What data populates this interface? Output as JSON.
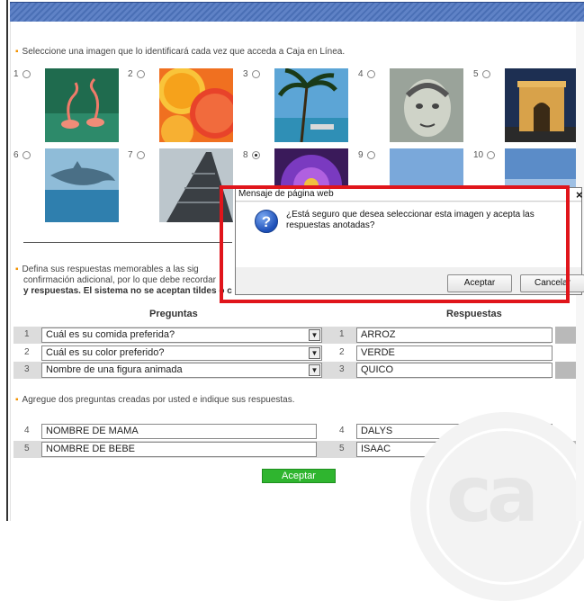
{
  "section1": {
    "instruction": "Seleccione una imagen que lo identificará cada vez que acceda a Caja en Línea."
  },
  "images": [
    {
      "num": "1",
      "subject": "flamingos",
      "selected": false
    },
    {
      "num": "2",
      "subject": "citrus slices",
      "selected": false
    },
    {
      "num": "3",
      "subject": "palm trees beach",
      "selected": false
    },
    {
      "num": "4",
      "subject": "dollar bill portrait",
      "selected": false
    },
    {
      "num": "5",
      "subject": "triumphal arch",
      "selected": false
    },
    {
      "num": "6",
      "subject": "dolphin",
      "selected": false
    },
    {
      "num": "7",
      "subject": "eiffel tower",
      "selected": false
    },
    {
      "num": "8",
      "subject": "purple flower",
      "selected": true
    },
    {
      "num": "9",
      "subject": "sky",
      "selected": false
    },
    {
      "num": "10",
      "subject": "sky horizon",
      "selected": false
    }
  ],
  "section2": {
    "line1": "Defina sus respuestas memorables a las sig",
    "line2": "confirmación adicional, por lo que debe recordar",
    "line3": "y respuestas. El sistema no se aceptan tildes o c"
  },
  "headers": {
    "questions": "Preguntas",
    "answers": "Respuestas"
  },
  "questions": [
    {
      "num": "1",
      "text": "Cuál es su comida preferida?",
      "answer_num": "1",
      "answer": "ARROZ"
    },
    {
      "num": "2",
      "text": "Cuál es su color preferido?",
      "answer_num": "2",
      "answer": "VERDE"
    },
    {
      "num": "3",
      "text": "Nombre de una figura animada",
      "answer_num": "3",
      "answer": "QUICO"
    }
  ],
  "section3": {
    "instruction": "Agregue dos preguntas creadas por usted e indique sus respuestas."
  },
  "custom_questions": [
    {
      "num": "4",
      "text": "NOMBRE DE MAMA",
      "answer_num": "4",
      "answer": "DALYS"
    },
    {
      "num": "5",
      "text": "NOMBRE DE BEBE",
      "answer_num": "5",
      "answer": "ISAAC"
    }
  ],
  "submit_label": "Aceptar",
  "logo_text": "ca",
  "dialog": {
    "title": "Mensaje de página web",
    "close": "×",
    "message": "¿Está seguro que desea seleccionar esta imagen y acepta las respuestas anotadas?",
    "ok": "Aceptar",
    "cancel": "Cancelar"
  },
  "colors": {
    "accent_bullet": "#f39200",
    "submit": "#2fb52f",
    "highlight_frame": "#e0151b",
    "topbar": "#4a6fb5"
  }
}
